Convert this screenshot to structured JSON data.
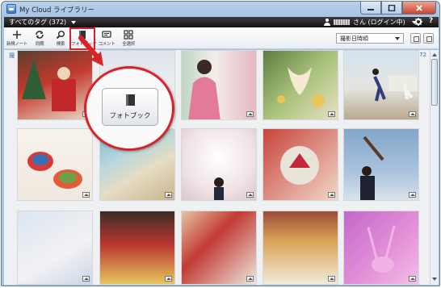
{
  "window": {
    "title": "My Cloud ライブラリー"
  },
  "header": {
    "tag_select": "すべてのタグ (372)",
    "user_status": "さん (ログイン中)",
    "settings_icon": "gear-icon",
    "help_label": "?"
  },
  "toolbar": {
    "tools": [
      {
        "label": "新規ノート",
        "icon": "plus-icon"
      },
      {
        "label": "同期",
        "icon": "sync-icon"
      },
      {
        "label": "検索",
        "icon": "search-icon"
      },
      {
        "label": "フォトブック",
        "icon": "photobook-icon"
      },
      {
        "label": "コメント",
        "icon": "comment-icon"
      },
      {
        "label": "全選択",
        "icon": "select-all-icon"
      }
    ],
    "sort_select": "撮影日時順"
  },
  "content": {
    "count_suffix": "72",
    "corner_text": "撮"
  },
  "callout": {
    "label": "フォトブック"
  },
  "colors": {
    "highlight": "#d9232a",
    "header_bg": "#1e1e1e",
    "link": "#3a6fb0"
  }
}
